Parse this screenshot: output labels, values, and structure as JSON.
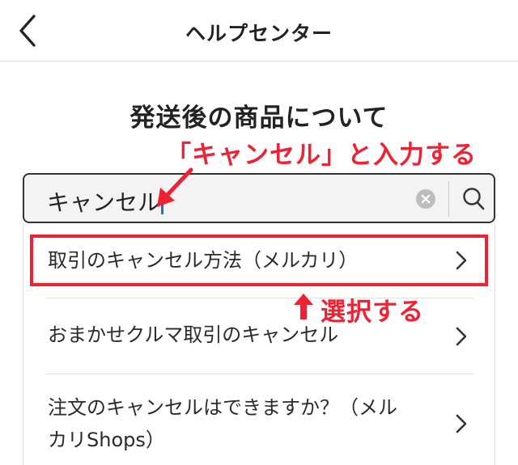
{
  "header": {
    "title": "ヘルプセンター",
    "back_icon": "chevron-left-icon"
  },
  "page": {
    "title": "発送後の商品について"
  },
  "search": {
    "value": "キャンセル",
    "clear_icon": "clear-icon",
    "search_icon": "search-icon"
  },
  "suggestions": [
    {
      "label": "取引のキャンセル方法（メルカリ）"
    },
    {
      "label": "おまかせクルマ取引のキャンセル"
    },
    {
      "label_line1": "注文のキャンセルはできますか？（メル",
      "label_line2": "カリShops）"
    }
  ],
  "annotations": {
    "instruction_type": "「キャンセル」と入力する",
    "instruction_select": "選択する",
    "color": "#ee2233"
  }
}
